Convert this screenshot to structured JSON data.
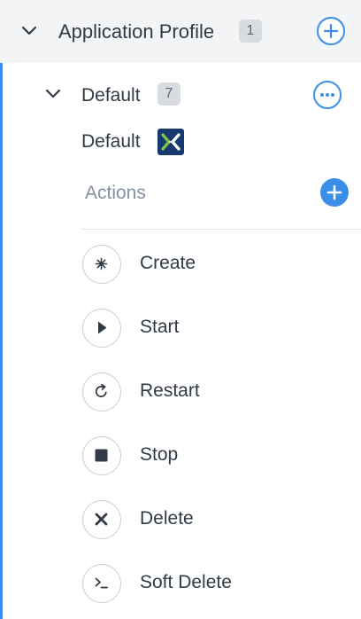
{
  "profile_section": {
    "title": "Application Profile",
    "count": "1",
    "add_icon": "plus-circle-icon"
  },
  "profile": {
    "name": "Default",
    "count": "7",
    "more_icon": "ellipsis-icon"
  },
  "deployment": {
    "name": "Default",
    "logo_icon": "nutanix-logo"
  },
  "actions_section": {
    "label": "Actions",
    "add_icon": "plus-icon"
  },
  "actions": [
    {
      "label": "Create",
      "icon": "create-icon"
    },
    {
      "label": "Start",
      "icon": "play-icon"
    },
    {
      "label": "Restart",
      "icon": "restart-icon"
    },
    {
      "label": "Stop",
      "icon": "stop-icon"
    },
    {
      "label": "Delete",
      "icon": "delete-icon"
    },
    {
      "label": "Soft Delete",
      "icon": "terminal-icon"
    }
  ],
  "colors": {
    "accent": "#3b8ee8",
    "text": "#313a46",
    "muted": "#8590a0",
    "header_bg": "#f3f4f6",
    "badge_bg": "#d8dce1",
    "logo_bg": "#16396f"
  }
}
